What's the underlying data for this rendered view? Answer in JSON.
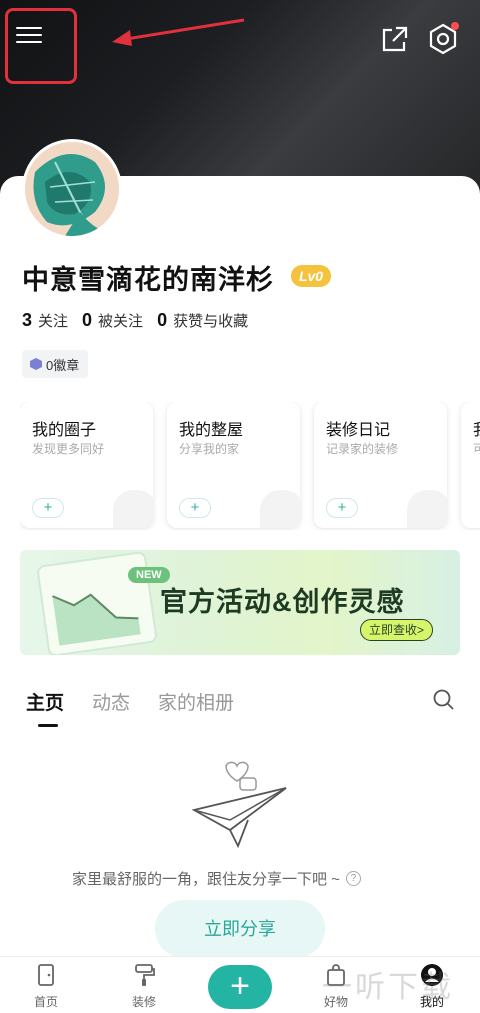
{
  "profile": {
    "username": "中意雪滴花的南洋杉",
    "level": "Lv0",
    "stats": [
      {
        "count": "3",
        "label": "关注"
      },
      {
        "count": "0",
        "label": "被关注"
      },
      {
        "count": "0",
        "label": "获赞与收藏"
      }
    ],
    "badge": "0徽章"
  },
  "features": [
    {
      "title": "我的圈子",
      "subtitle": "发现更多同好",
      "plus": "+"
    },
    {
      "title": "我的整屋",
      "subtitle": "分享我的家",
      "plus": "+"
    },
    {
      "title": "装修日记",
      "subtitle": "记录家的装修",
      "plus": "+"
    },
    {
      "title": "我",
      "subtitle": "可",
      "plus": "+"
    }
  ],
  "banner": {
    "new_tag": "NEW",
    "title": "官方活动&创作灵感",
    "button": "立即查收>"
  },
  "tabs": [
    "主页",
    "动态",
    "家的相册"
  ],
  "empty": {
    "text": "家里最舒服的一角，跟住友分享一下吧 ~",
    "help": "?",
    "button": "立即分享"
  },
  "bottom_nav": {
    "home": "首页",
    "decor": "装修",
    "add": "+",
    "goods": "好物",
    "mine": "我的"
  },
  "watermark": "一听下载",
  "colors": {
    "accent": "#23b4a4",
    "level_badge": "#f4c23c",
    "annotation_red": "#e0313c"
  }
}
